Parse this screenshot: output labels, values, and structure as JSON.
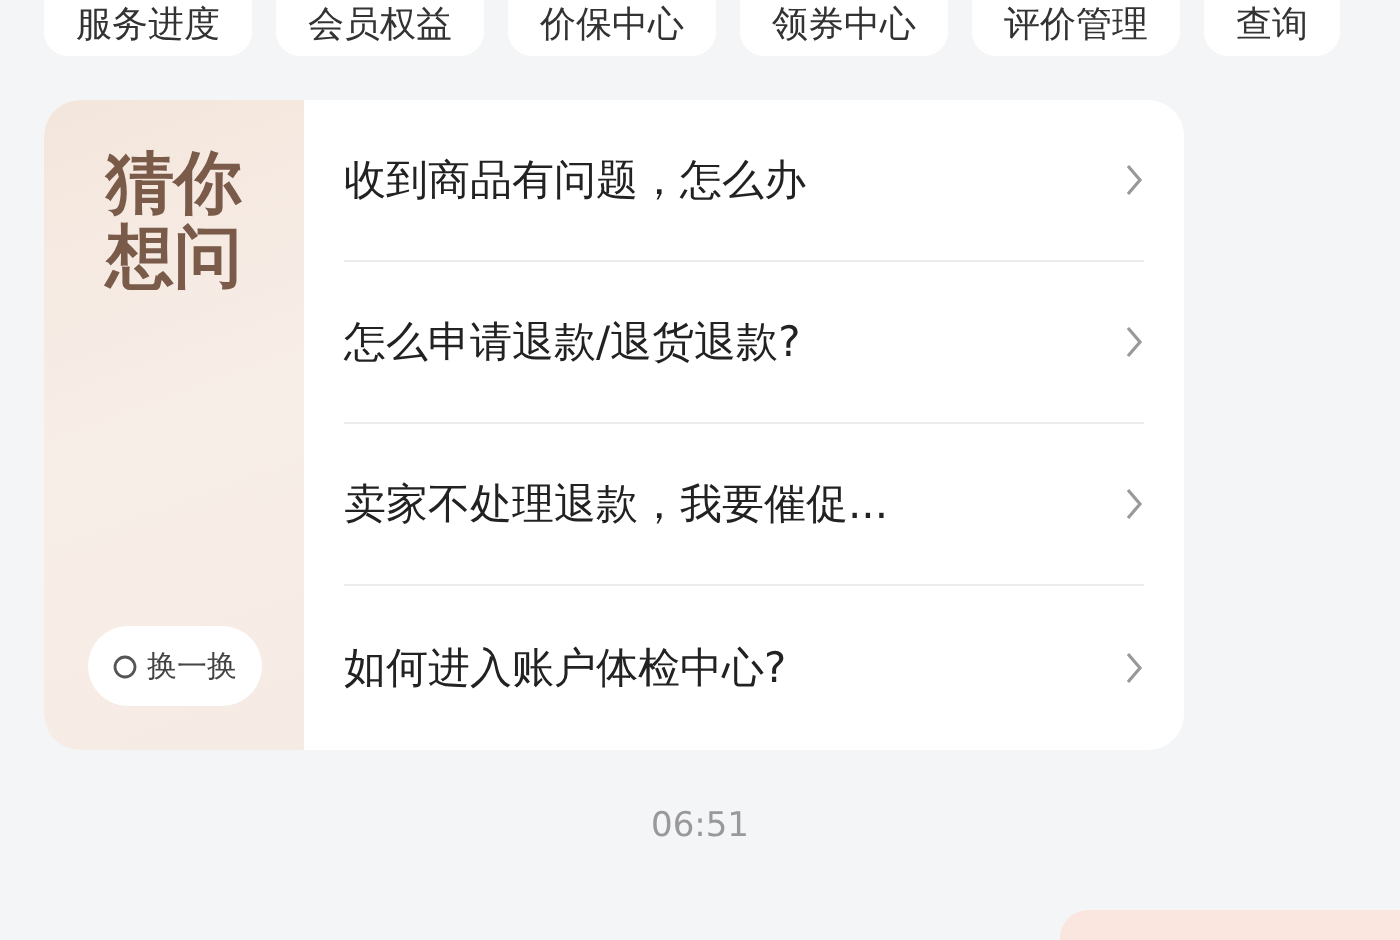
{
  "shortcuts": [
    {
      "label": "服务进度"
    },
    {
      "label": "会员权益"
    },
    {
      "label": "价保中心"
    },
    {
      "label": "领券中心"
    },
    {
      "label": "评价管理"
    },
    {
      "label": "查询"
    }
  ],
  "suggestions": {
    "title_lines": [
      "猜你想问"
    ],
    "refresh_button": "换一换",
    "questions": [
      {
        "text": "收到商品有问题，怎么办"
      },
      {
        "text": "怎么申请退款/退货退款?"
      },
      {
        "text": "卖家不处理退款，我要催促..."
      },
      {
        "text": "如何进入账户体检中心?"
      }
    ]
  },
  "timestamp": "06:51"
}
